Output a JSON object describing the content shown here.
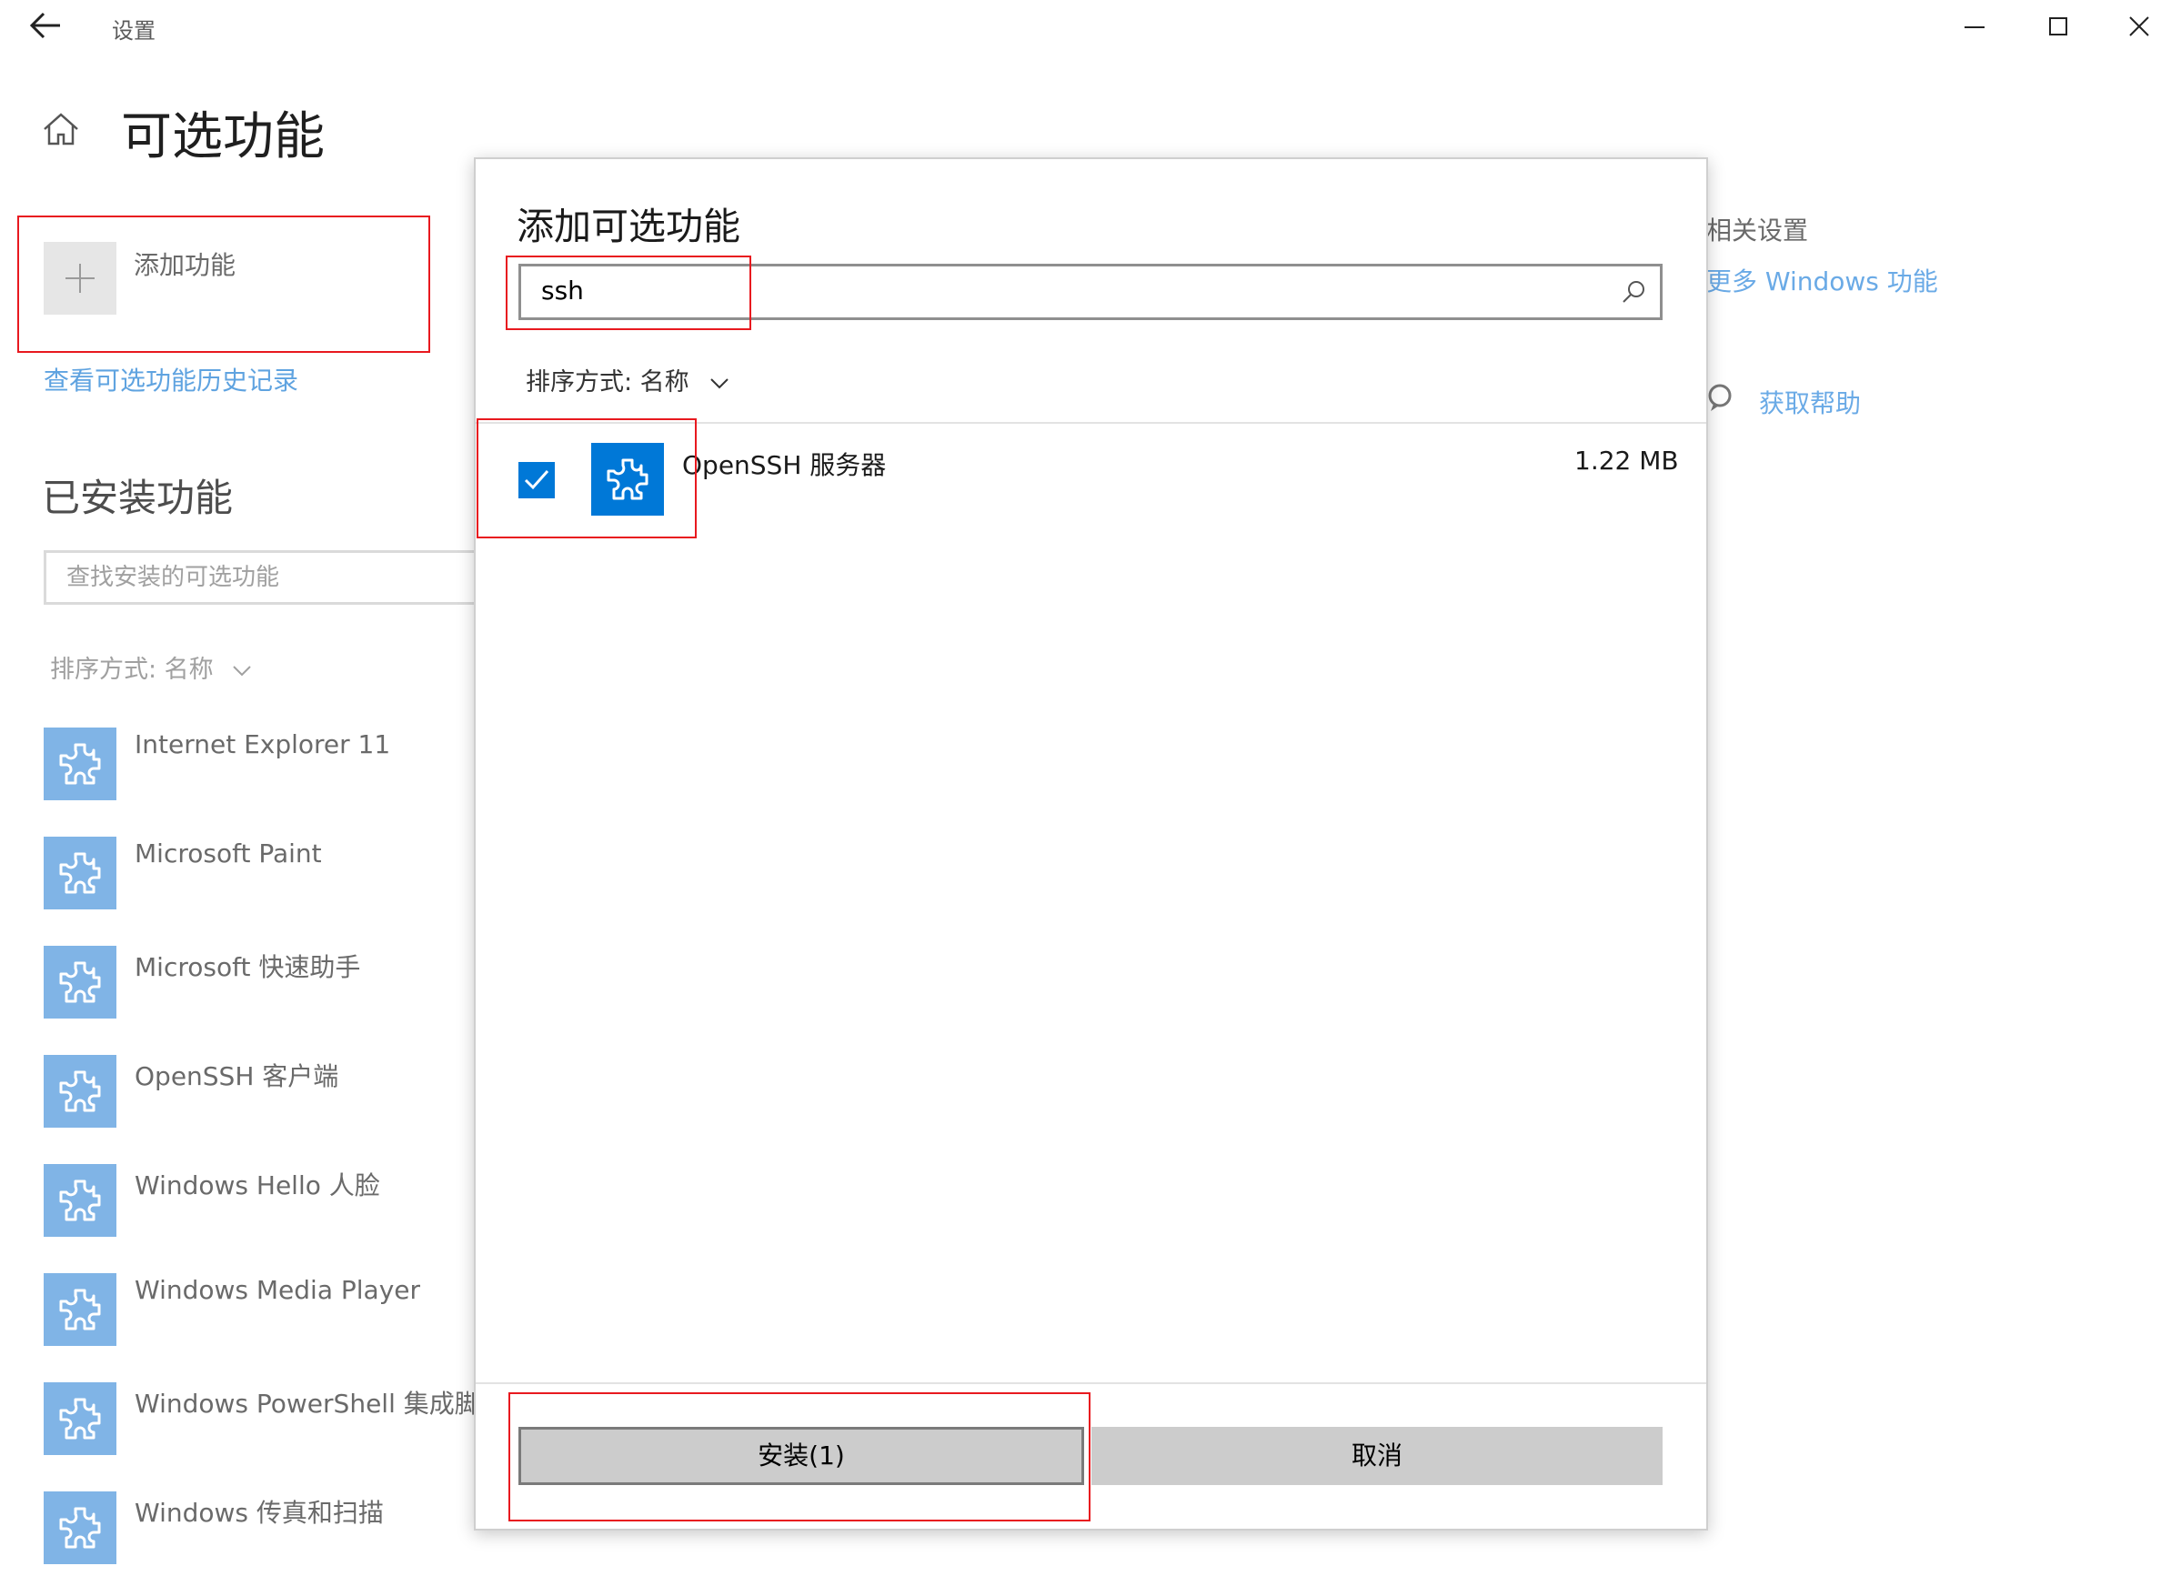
{
  "window": {
    "title": "设置",
    "back_icon": "back-arrow-icon",
    "controls": [
      "minimize-icon",
      "maximize-icon",
      "close-icon"
    ]
  },
  "page": {
    "title": "可选功能",
    "home_icon": "home-icon"
  },
  "add_feature": {
    "label": "添加功能",
    "icon": "plus-icon"
  },
  "history_link": "查看可选功能历史记录",
  "installed": {
    "heading": "已安装功能",
    "search_placeholder": "查找安装的可选功能",
    "sort_label": "排序方式: 名称",
    "items": [
      {
        "name": "Internet Explorer 11"
      },
      {
        "name": "Microsoft Paint"
      },
      {
        "name": "Microsoft 快速助手"
      },
      {
        "name": "OpenSSH 客户端"
      },
      {
        "name": "Windows Hello 人脸"
      },
      {
        "name": "Windows Media Player"
      },
      {
        "name": "Windows PowerShell 集成脚本"
      },
      {
        "name": "Windows 传真和扫描"
      }
    ]
  },
  "related": {
    "title": "相关设置",
    "more_windows": "更多 Windows 功能",
    "help": "获取帮助"
  },
  "dialog": {
    "title": "添加可选功能",
    "search_value": "ssh",
    "sort_label": "排序方式: 名称",
    "results": [
      {
        "name": "OpenSSH 服务器",
        "size": "1.22 MB",
        "checked": true
      }
    ],
    "install_label": "安装(1)",
    "cancel_label": "取消"
  },
  "colors": {
    "accent": "#0078d7",
    "link": "#6aaae6",
    "annotation": "#e8191f"
  }
}
